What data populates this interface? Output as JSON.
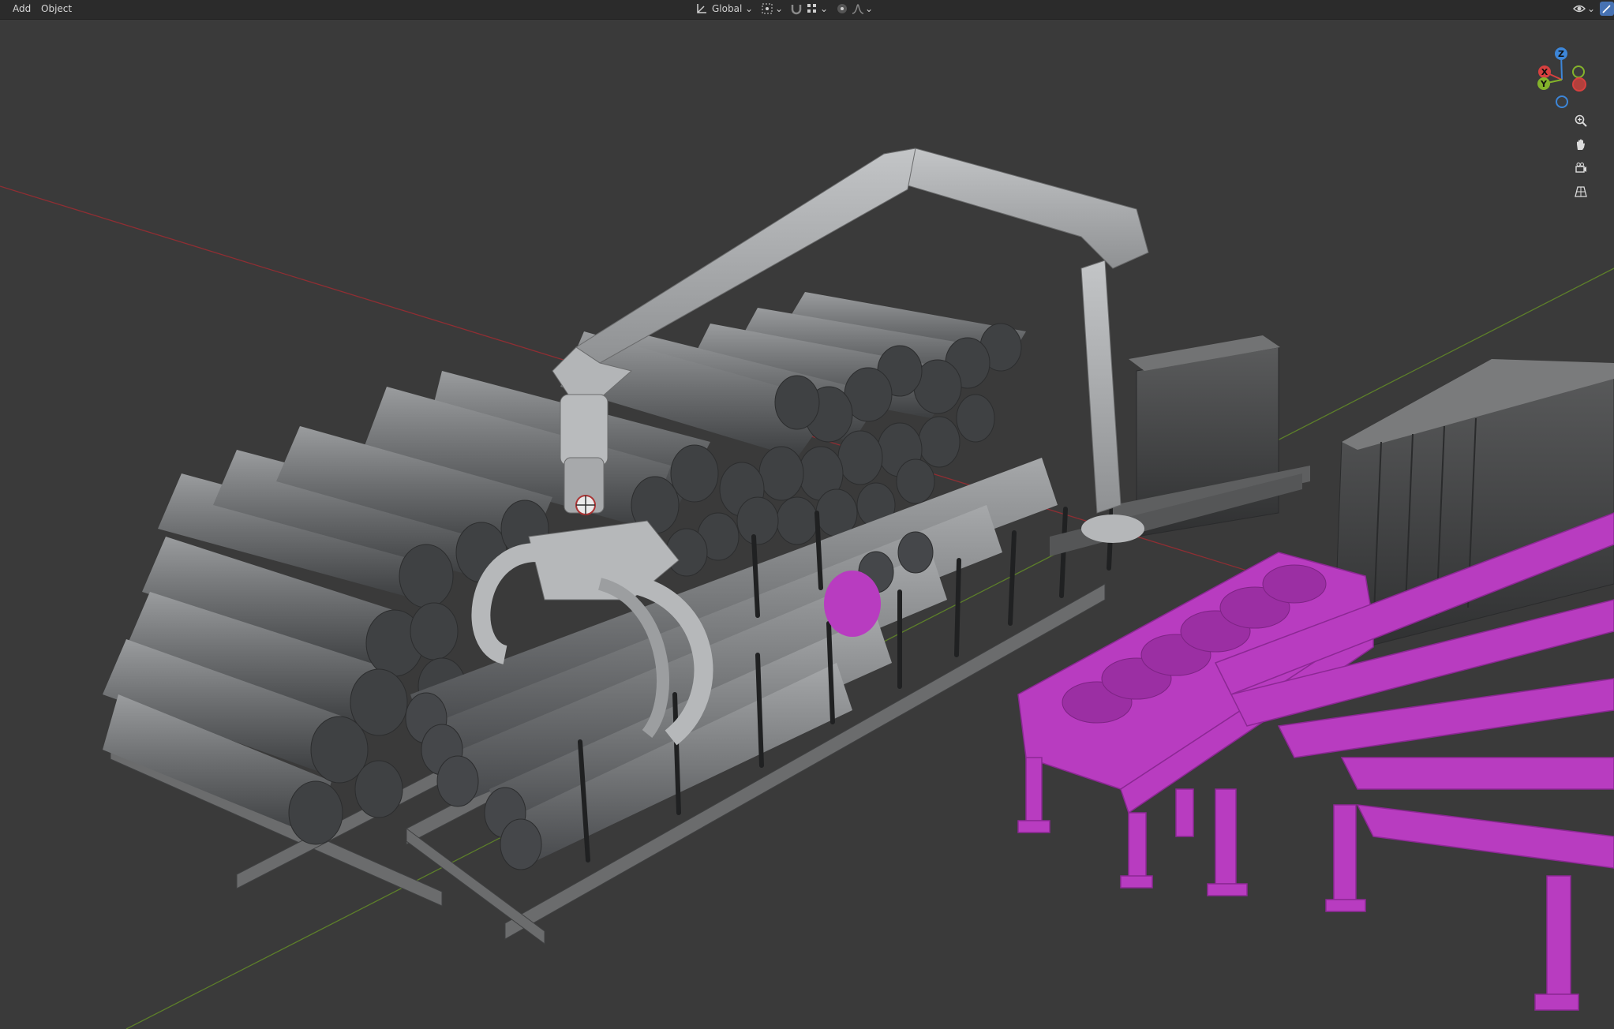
{
  "header": {
    "menu_add": "Add",
    "menu_object": "Object",
    "transform_orientation": "Global",
    "icons": {
      "orientation": "transform-orientation-icon",
      "pivot": "pivot-point-icon",
      "snap": "snap-magnet-icon",
      "snap_target": "snap-increment-icon",
      "proportional": "proportional-editing-icon",
      "falloff": "falloff-curve-icon",
      "visibility": "eye-visibility-icon",
      "gizmo_toggle": "gizmo-toggle-icon"
    }
  },
  "gizmo": {
    "axis_z": "Z",
    "axis_x": "X",
    "axis_y": "Y",
    "colors": {
      "x": "#d7403f",
      "y": "#84b32b",
      "z": "#3d86d8"
    }
  },
  "nav_buttons": {
    "zoom": "zoom-icon",
    "pan": "hand-pan-icon",
    "camera": "camera-view-icon",
    "ortho": "orthographic-grid-icon"
  },
  "scene": {
    "background": "#3a3a3a",
    "selected_color": "#b83cc0",
    "x_axis_color": "#8f2e33",
    "y_axis_color": "#5d7f2a",
    "crane_color": "#a7a9ab",
    "log_color": "#707274"
  }
}
